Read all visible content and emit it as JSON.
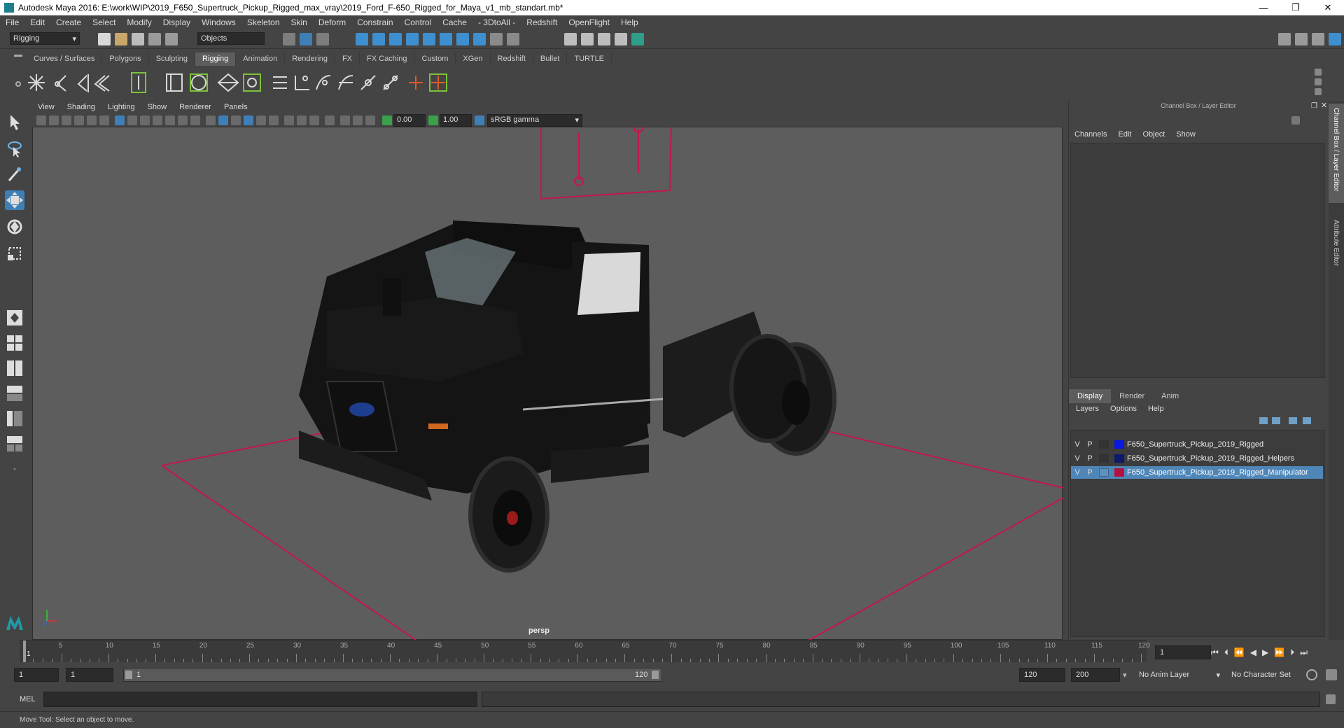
{
  "window": {
    "title": "Autodesk Maya 2016: E:\\work\\WIP\\2019_F650_Supertruck_Pickup_Rigged_max_vray\\2019_Ford_F-650_Rigged_for_Maya_v1_mb_standart.mb*",
    "minimize": "—",
    "maximize": "❐",
    "close": "✕"
  },
  "menubar": [
    "File",
    "Edit",
    "Create",
    "Select",
    "Modify",
    "Display",
    "Windows",
    "Skeleton",
    "Skin",
    "Deform",
    "Constrain",
    "Control",
    "Cache",
    "- 3DtoAll -",
    "Redshift",
    "OpenFlight",
    "Help"
  ],
  "statusline": {
    "menuset": "Rigging",
    "selection_mode": "Objects"
  },
  "shelf_tabs": [
    "Curves / Surfaces",
    "Polygons",
    "Sculpting",
    "Rigging",
    "Animation",
    "Rendering",
    "FX",
    "FX Caching",
    "Custom",
    "XGen",
    "Redshift",
    "Bullet",
    "TURTLE"
  ],
  "active_shelf": "Rigging",
  "viewport": {
    "menu": [
      "View",
      "Shading",
      "Lighting",
      "Show",
      "Renderer",
      "Panels"
    ],
    "exposure": "0.00",
    "gamma": "1.00",
    "color_space": "sRGB gamma",
    "camera": "persp"
  },
  "channel_box": {
    "title": "Channel Box / Layer Editor",
    "menu": [
      "Channels",
      "Edit",
      "Object",
      "Show"
    ]
  },
  "layer_editor": {
    "tabs": [
      "Display",
      "Render",
      "Anim"
    ],
    "active_tab": "Display",
    "menu": [
      "Layers",
      "Options",
      "Help"
    ],
    "layers": [
      {
        "v": "V",
        "p": "P",
        "color": "#0a18e0",
        "name": "F650_Supertruck_Pickup_2019_Rigged",
        "selected": false
      },
      {
        "v": "V",
        "p": "P",
        "color": "#0d1a6a",
        "name": "F650_Supertruck_Pickup_2019_Rigged_Helpers",
        "selected": false
      },
      {
        "v": "V",
        "p": "P",
        "color": "#b5103f",
        "name": "F650_Supertruck_Pickup_2019_Rigged_Manipulator",
        "selected": true
      }
    ]
  },
  "side_tabs": [
    "Channel Box / Layer Editor",
    "Attribute Editor"
  ],
  "timeline": {
    "ticks": [
      "5",
      "10",
      "15",
      "20",
      "25",
      "30",
      "35",
      "40",
      "45",
      "50",
      "55",
      "60",
      "65",
      "70",
      "75",
      "80",
      "85",
      "90",
      "95",
      "100",
      "105",
      "110",
      "115",
      "120"
    ],
    "current_frame_marker": "1",
    "current_frame": "1"
  },
  "range": {
    "start": "1",
    "playback_start": "1",
    "slider_start": "1",
    "slider_end": "120",
    "playback_end": "120",
    "end": "200",
    "anim_layer": "No Anim Layer",
    "character_set": "No Character Set"
  },
  "command_line": {
    "label": "MEL"
  },
  "help_line": "Move Tool: Select an object to move."
}
